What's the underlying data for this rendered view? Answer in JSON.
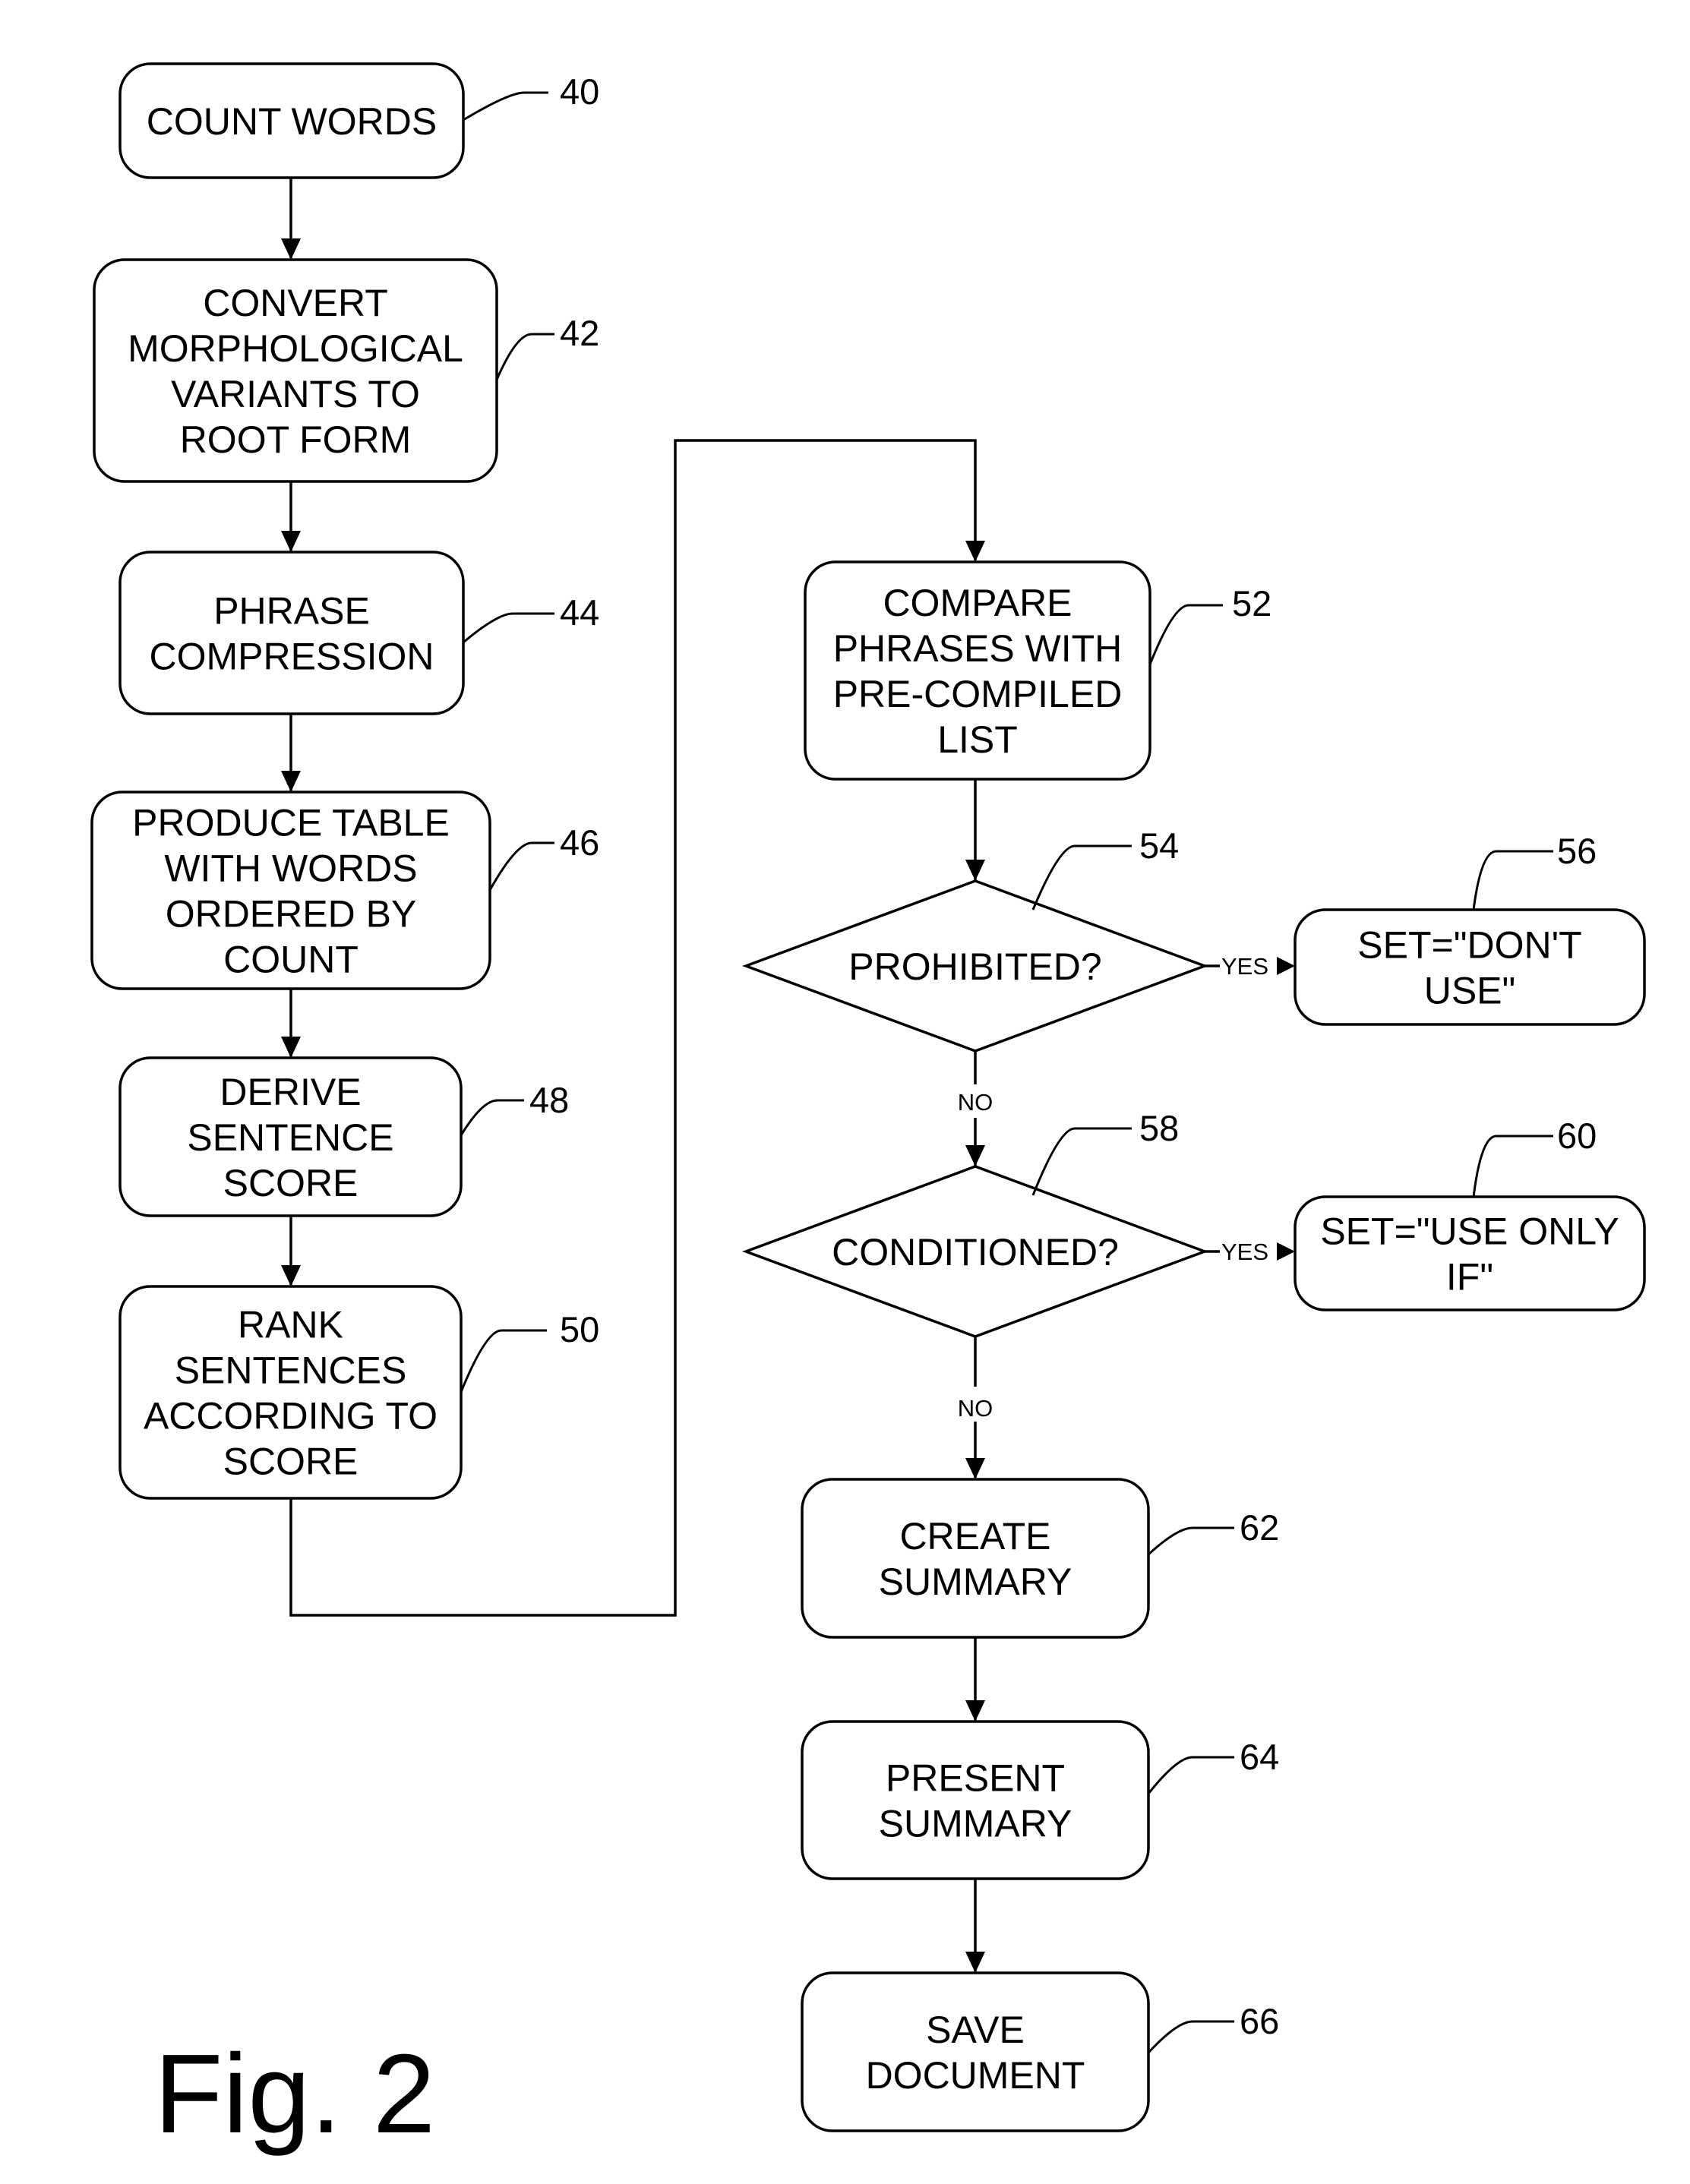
{
  "figure": {
    "label": "Fig. 2",
    "type": "flowchart"
  },
  "nodes": [
    {
      "id": "40",
      "ref": "40",
      "shape": "process",
      "lines": [
        "COUNT WORDS"
      ]
    },
    {
      "id": "42",
      "ref": "42",
      "shape": "process",
      "lines": [
        "CONVERT",
        "MORPHOLOGICAL",
        "VARIANTS TO",
        "ROOT FORM"
      ]
    },
    {
      "id": "44",
      "ref": "44",
      "shape": "process",
      "lines": [
        "PHRASE",
        "COMPRESSION"
      ]
    },
    {
      "id": "46",
      "ref": "46",
      "shape": "process",
      "lines": [
        "PRODUCE TABLE",
        "WITH WORDS",
        "ORDERED BY",
        "COUNT"
      ]
    },
    {
      "id": "48",
      "ref": "48",
      "shape": "process",
      "lines": [
        "DERIVE",
        "SENTENCE",
        "SCORE"
      ]
    },
    {
      "id": "50",
      "ref": "50",
      "shape": "process",
      "lines": [
        "RANK",
        "SENTENCES",
        "ACCORDING TO",
        "SCORE"
      ]
    },
    {
      "id": "52",
      "ref": "52",
      "shape": "process",
      "lines": [
        "COMPARE",
        "PHRASES WITH",
        "PRE-COMPILED",
        "LIST"
      ]
    },
    {
      "id": "54",
      "ref": "54",
      "shape": "decision",
      "lines": [
        "PROHIBITED?"
      ]
    },
    {
      "id": "56",
      "ref": "56",
      "shape": "process",
      "lines": [
        "SET=\"DON'T",
        "USE\""
      ]
    },
    {
      "id": "58",
      "ref": "58",
      "shape": "decision",
      "lines": [
        "CONDITIONED?"
      ]
    },
    {
      "id": "60",
      "ref": "60",
      "shape": "process",
      "lines": [
        "SET=\"USE ONLY",
        "IF\""
      ]
    },
    {
      "id": "62",
      "ref": "62",
      "shape": "process",
      "lines": [
        "CREATE",
        "SUMMARY"
      ]
    },
    {
      "id": "64",
      "ref": "64",
      "shape": "process",
      "lines": [
        "PRESENT",
        "SUMMARY"
      ]
    },
    {
      "id": "66",
      "ref": "66",
      "shape": "process",
      "lines": [
        "SAVE",
        "DOCUMENT"
      ]
    }
  ],
  "edges": [
    {
      "from": "40",
      "to": "42",
      "label": ""
    },
    {
      "from": "42",
      "to": "44",
      "label": ""
    },
    {
      "from": "44",
      "to": "46",
      "label": ""
    },
    {
      "from": "46",
      "to": "48",
      "label": ""
    },
    {
      "from": "48",
      "to": "50",
      "label": ""
    },
    {
      "from": "50",
      "to": "52",
      "label": ""
    },
    {
      "from": "52",
      "to": "54",
      "label": ""
    },
    {
      "from": "54",
      "to": "56",
      "label": "YES"
    },
    {
      "from": "54",
      "to": "58",
      "label": "NO"
    },
    {
      "from": "58",
      "to": "60",
      "label": "YES"
    },
    {
      "from": "58",
      "to": "62",
      "label": "NO"
    },
    {
      "from": "62",
      "to": "64",
      "label": ""
    },
    {
      "from": "64",
      "to": "66",
      "label": ""
    }
  ],
  "colors": {
    "ink": "#000000",
    "paper": "#ffffff"
  }
}
